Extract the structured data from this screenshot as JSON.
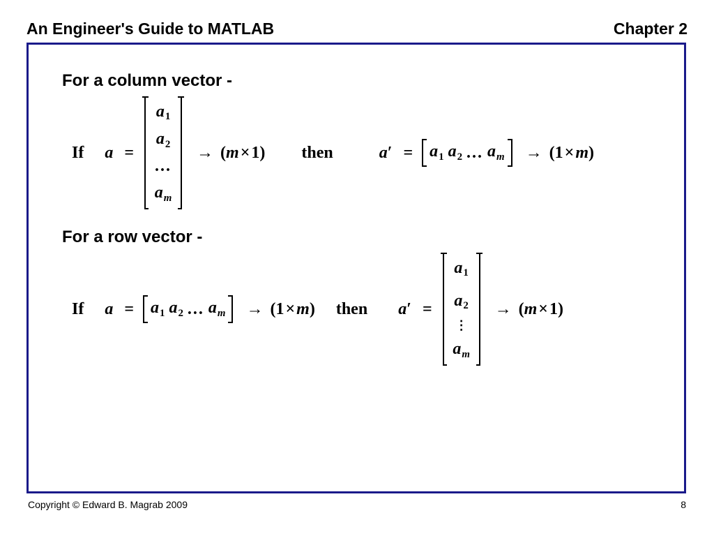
{
  "header": {
    "title_left": "An Engineer's Guide to MATLAB",
    "title_right": "Chapter 2"
  },
  "footer": {
    "copyright": "Copyright © Edward B. Magrab 2009",
    "page_number": "8"
  },
  "section1": {
    "title": "For a column vector -",
    "if": "If",
    "a": "a",
    "eq": "=",
    "elems": {
      "a1": "a",
      "s1": "1",
      "a2": "a",
      "s2": "2",
      "dots": "...",
      "am": "a",
      "sm": "m"
    },
    "arrow": "→",
    "dim1_open": "(",
    "dim1_m": "m",
    "dim1_x": "×",
    "dim1_one": "1",
    "dim1_close": ")",
    "then": "then",
    "ap": "a",
    "prime": "′",
    "dim2_open": "(",
    "dim2_one": "1",
    "dim2_x": "×",
    "dim2_m": "m",
    "dim2_close": ")"
  },
  "section2": {
    "title": "For a row vector -",
    "if": "If",
    "a": "a",
    "eq": "=",
    "elems": {
      "a1": "a",
      "s1": "1",
      "a2": "a",
      "s2": "2",
      "dots": "...",
      "am": "a",
      "sm": "m"
    },
    "arrow": "→",
    "dim1_open": "(",
    "dim1_one": "1",
    "dim1_x": "×",
    "dim1_m": "m",
    "dim1_close": ")",
    "then": "then",
    "ap": "a",
    "prime": "′",
    "vdots": "⋮",
    "dim2_open": "(",
    "dim2_m": "m",
    "dim2_x": "×",
    "dim2_one": "1",
    "dim2_close": ")"
  }
}
